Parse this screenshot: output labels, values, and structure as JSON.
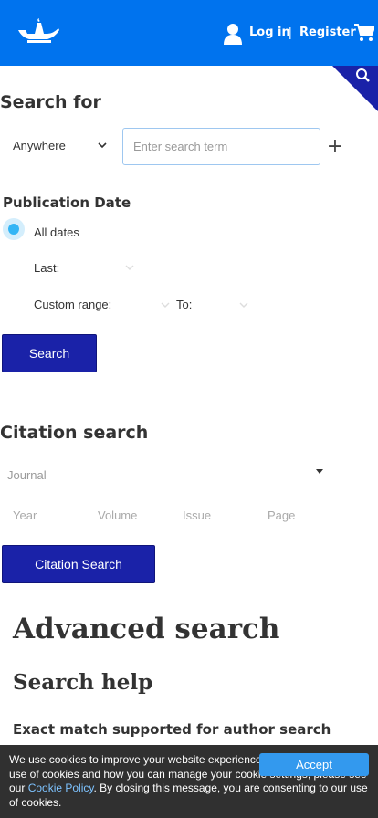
{
  "header": {
    "logo_icon": "lamp-logo-icon",
    "login_label": "Log in",
    "separator": "|",
    "register_label": "Register",
    "user_icon": "user-icon",
    "cart_icon": "cart-icon",
    "brand_color": "#0073ee"
  },
  "search_corner": {
    "icon": "search-icon",
    "color": "#1a22a8"
  },
  "search_for": {
    "title": "Search for",
    "scope_value": "Anywhere",
    "input_placeholder": "Enter search term",
    "add_label": "+"
  },
  "publication_date": {
    "title": "Publication Date",
    "all_dates_label": "All dates",
    "all_dates_selected": true,
    "last_label": "Last:",
    "custom_range_label": "Custom range:",
    "to_label": "To:"
  },
  "search_button_label": "Search",
  "citation": {
    "title": "Citation search",
    "journal_placeholder": "Journal",
    "year_placeholder": "Year",
    "volume_placeholder": "Volume",
    "issue_placeholder": "Issue",
    "page_placeholder": "Page",
    "button_label": "Citation Search"
  },
  "advanced_search_title": "Advanced search",
  "search_help_title": "Search help",
  "exact_match_text": "Exact match supported for author search",
  "cookie_banner": {
    "text_before": "We use cookies to improve your website experience. To learn about our use of cookies and how you can manage your cookie settings, please see our ",
    "link_text": "Cookie Policy",
    "text_after": ". By closing this message, you are consenting to our use of cookies.",
    "accept_label": "Accept"
  }
}
